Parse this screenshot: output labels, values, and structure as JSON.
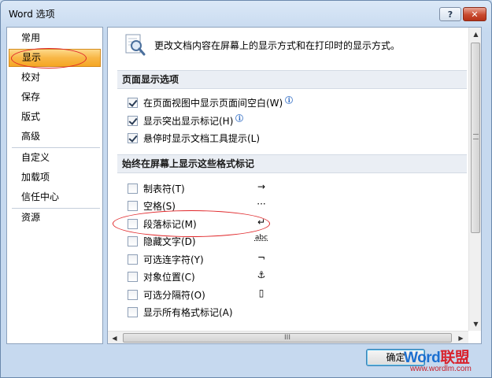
{
  "window": {
    "title": "Word 选项",
    "help_glyph": "?",
    "close_glyph": "✕"
  },
  "nav": {
    "items": [
      {
        "label": "常用"
      },
      {
        "label": "显示"
      },
      {
        "label": "校对"
      },
      {
        "label": "保存"
      },
      {
        "label": "版式"
      },
      {
        "label": "高级"
      },
      {
        "label": "自定义"
      },
      {
        "label": "加载项"
      },
      {
        "label": "信任中心"
      },
      {
        "label": "资源"
      }
    ],
    "selected": "显示"
  },
  "intro": {
    "icon": "magnifier-document-icon",
    "text": "更改文档内容在屏幕上的显示方式和在打印时的显示方式。"
  },
  "page_display": {
    "heading": "页面显示选项",
    "options": [
      {
        "label": "在页面视图中显示页面间空白(W)",
        "checked": true,
        "info": true
      },
      {
        "label": "显示突出显示标记(H)",
        "checked": true,
        "info": true
      },
      {
        "label": "悬停时显示文档工具提示(L)",
        "checked": true,
        "info": false
      }
    ]
  },
  "formatting_marks": {
    "heading": "始终在屏幕上显示这些格式标记",
    "options": [
      {
        "label": "制表符(T)",
        "checked": false,
        "symbol": "→"
      },
      {
        "label": "空格(S)",
        "checked": false,
        "symbol": "···"
      },
      {
        "label": "段落标记(M)",
        "checked": false,
        "symbol": "↵"
      },
      {
        "label": "隐藏文字(D)",
        "checked": false,
        "symbol": "abc"
      },
      {
        "label": "可选连字符(Y)",
        "checked": false,
        "symbol": "¬"
      },
      {
        "label": "对象位置(C)",
        "checked": false,
        "symbol": "⚓"
      },
      {
        "label": "可选分隔符(O)",
        "checked": false,
        "symbol": "▯"
      },
      {
        "label": "显示所有格式标记(A)",
        "checked": false,
        "symbol": ""
      }
    ]
  },
  "scrollbar": {
    "grip": "III"
  },
  "buttons": {
    "ok": "确定"
  },
  "watermark": {
    "logo_blue": "Word",
    "logo_red": "联盟",
    "url": "www.wordlm.com"
  },
  "colors": {
    "accent_orange": "#f8b746",
    "highlight_red": "#e0272a",
    "frame_blue": "#8da2bd"
  }
}
